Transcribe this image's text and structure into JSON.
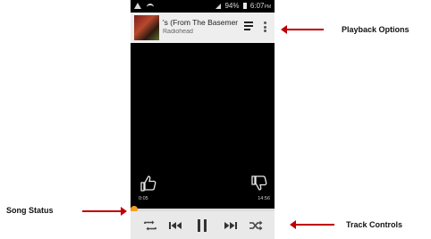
{
  "status_bar": {
    "battery": "94%",
    "time": "6:07",
    "ampm": "PM"
  },
  "now_playing": {
    "title": "'s (From The Basement)",
    "artist": "Radiohead"
  },
  "playback": {
    "elapsed": "0:05",
    "total": "14:56",
    "progress_fraction": 0.01
  },
  "callouts": {
    "playback_options": "Playback Options",
    "song_status": "Song Status",
    "track_controls": "Track Controls"
  },
  "colors": {
    "accent": "#f5a020",
    "arrow": "#c00000",
    "control_bar": "#e9e9e9"
  },
  "icons": {
    "queue": "queue-music-icon",
    "overflow": "more-vert-icon",
    "thumbs_up": "thumbs-up-icon",
    "thumbs_down": "thumbs-down-icon",
    "repeat": "repeat-icon",
    "previous": "skip-previous-icon",
    "pause": "pause-icon",
    "next": "skip-next-icon",
    "shuffle": "shuffle-icon"
  }
}
